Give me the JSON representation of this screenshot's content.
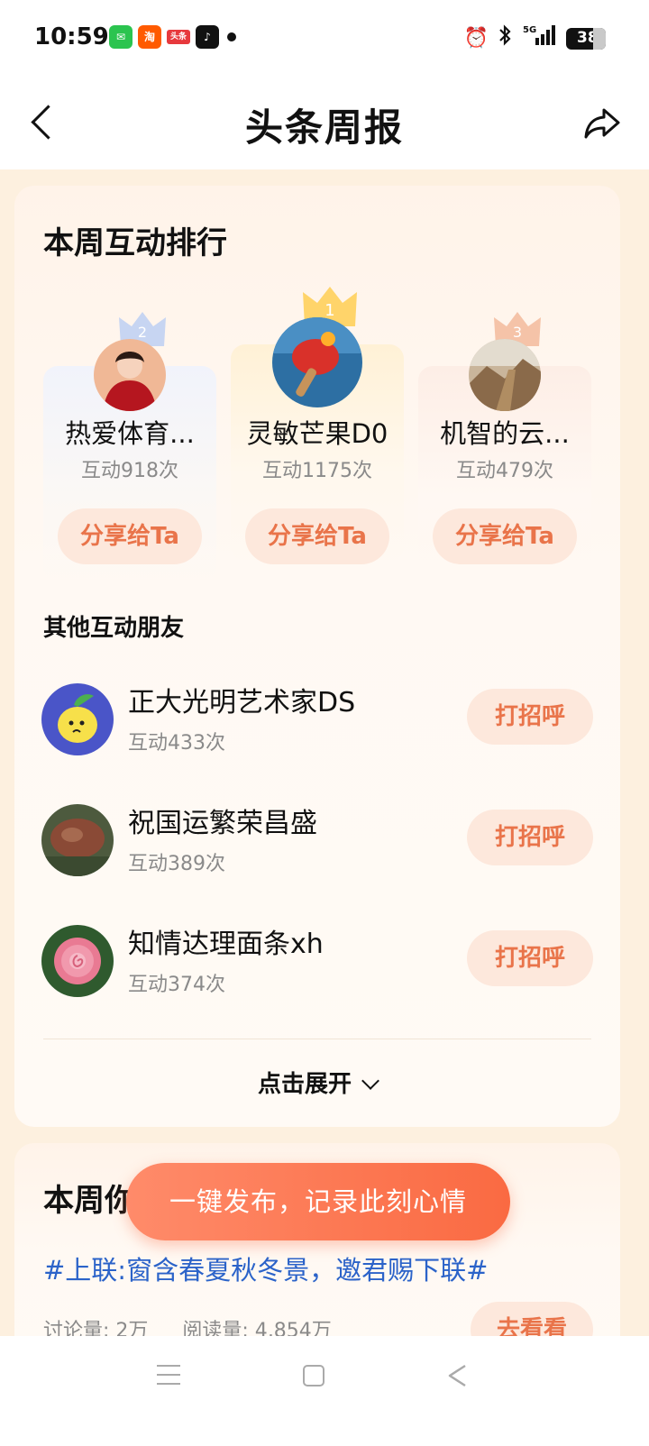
{
  "status_bar": {
    "time": "10:59",
    "network": "5G",
    "battery": "38",
    "apps": [
      "wechat-icon",
      "taobao-icon",
      "toutiao-icon",
      "tiktok-icon"
    ]
  },
  "header": {
    "title": "头条周报"
  },
  "ranking": {
    "title": "本周互动排行",
    "top": [
      {
        "rank": "1",
        "name": "灵敏芒果D0",
        "count": "互动1175次",
        "share_label": "分享给Ta"
      },
      {
        "rank": "2",
        "name": "热爱体育...",
        "count": "互动918次",
        "share_label": "分享给Ta"
      },
      {
        "rank": "3",
        "name": "机智的云...",
        "count": "互动479次",
        "share_label": "分享给Ta"
      }
    ],
    "others_title": "其他互动朋友",
    "others": [
      {
        "name": "正大光明艺术家DS",
        "count": "互动433次",
        "greet_label": "打招呼"
      },
      {
        "name": "祝国运繁荣昌盛",
        "count": "互动389次",
        "greet_label": "打招呼"
      },
      {
        "name": "知情达理面条xh",
        "count": "互动374次",
        "greet_label": "打招呼"
      }
    ],
    "expand_label": "点击展开"
  },
  "card2": {
    "title_visible": "本周你",
    "topic": "#上联:窗含春夏秋冬景，邀君赐下联#",
    "discuss": "讨论量: 2万",
    "reads": "阅读量: 4,854万",
    "go_label": "去看看"
  },
  "fab": {
    "label": "一键发布，记录此刻心情"
  },
  "colors": {
    "accent": "#fa6a42",
    "pill_bg": "#fde8dc",
    "pill_text": "#e9744a",
    "topic_link": "#2b63c9",
    "page_bg": "#fdf0df"
  }
}
